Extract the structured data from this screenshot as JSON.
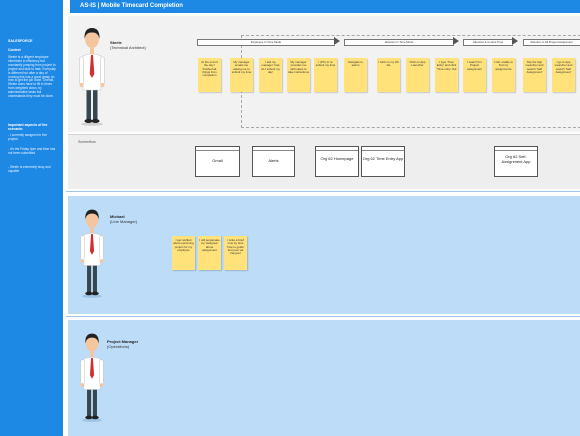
{
  "app": {
    "title": "AS-IS  | Mobile Timecard Completion"
  },
  "sidebar": {
    "title": "SALESFORCE",
    "context_heading": "Context",
    "context_text": "Steele is a diligent employee interested in efficiency but constantly jumping from project to project and task to task. Everyday is different but after a day of running this has a good grasp on how to get the job done. Overall, Steele does have to fill in times from weighted down, by administrative tasks but understands they must be done.",
    "aspects_heading": "Important aspects of the scenario:",
    "aspect_1": "- I currently assigned to five project.",
    "aspect_2": "- It's the Friday 4pm and time has not been submitted",
    "aspect_3": "- Steele is extremely busy and capable"
  },
  "personas": {
    "steele": {
      "name": "Steele",
      "role": "(Technical Architect)"
    },
    "michael": {
      "name": "Michael",
      "role": "(Line Manager)"
    },
    "pm": {
      "name": "Project Manager",
      "role": "(Operations)"
    }
  },
  "phases": [
    {
      "label": "Employee In Time Mode"
    },
    {
      "label": "Attention in Time Mode"
    },
    {
      "label": "Attention  & Control Time"
    },
    {
      "label": "Attention in All Project Assignment"
    }
  ],
  "steele_notes": [
    "At the end of the day I finished all things from completion",
    "My manager emails me asking me to submit my time",
    "I ask my manager 'how do I submit my day'",
    "My manager provides me with steps to take instructions",
    "I (PC) to re submit my time",
    "Navigate to admin",
    "I click on my 2D tile",
    "Click on App Launcher",
    "I type 'Time Entry' and click 'Time entry' link",
    "I search for Project assignment",
    "I can unable to find my assignments",
    "Tap the App Launcher and search 'Self Assignment'",
    "I go to App Launcher and search 'Self Assignment'"
  ],
  "michael_notes": [
    "I get notified about upcoming project for my employee",
    "I will perpetuate my 'assignee' about assignment",
    "I write a brief note by time 'how to guide' and post via hangout"
  ],
  "screens": {
    "label": "Screenflow",
    "items": [
      "Gmail",
      "Alerts",
      "Org 62 Homepage",
      "Org 62 Time Entry App",
      "Org 62 Self-Assignment App"
    ]
  },
  "colors": {
    "accent": "#1e88e5",
    "sticky": "#ffe27a",
    "lane_blue": "#bcdcf8",
    "lane_grey": "#f2f2f2"
  }
}
